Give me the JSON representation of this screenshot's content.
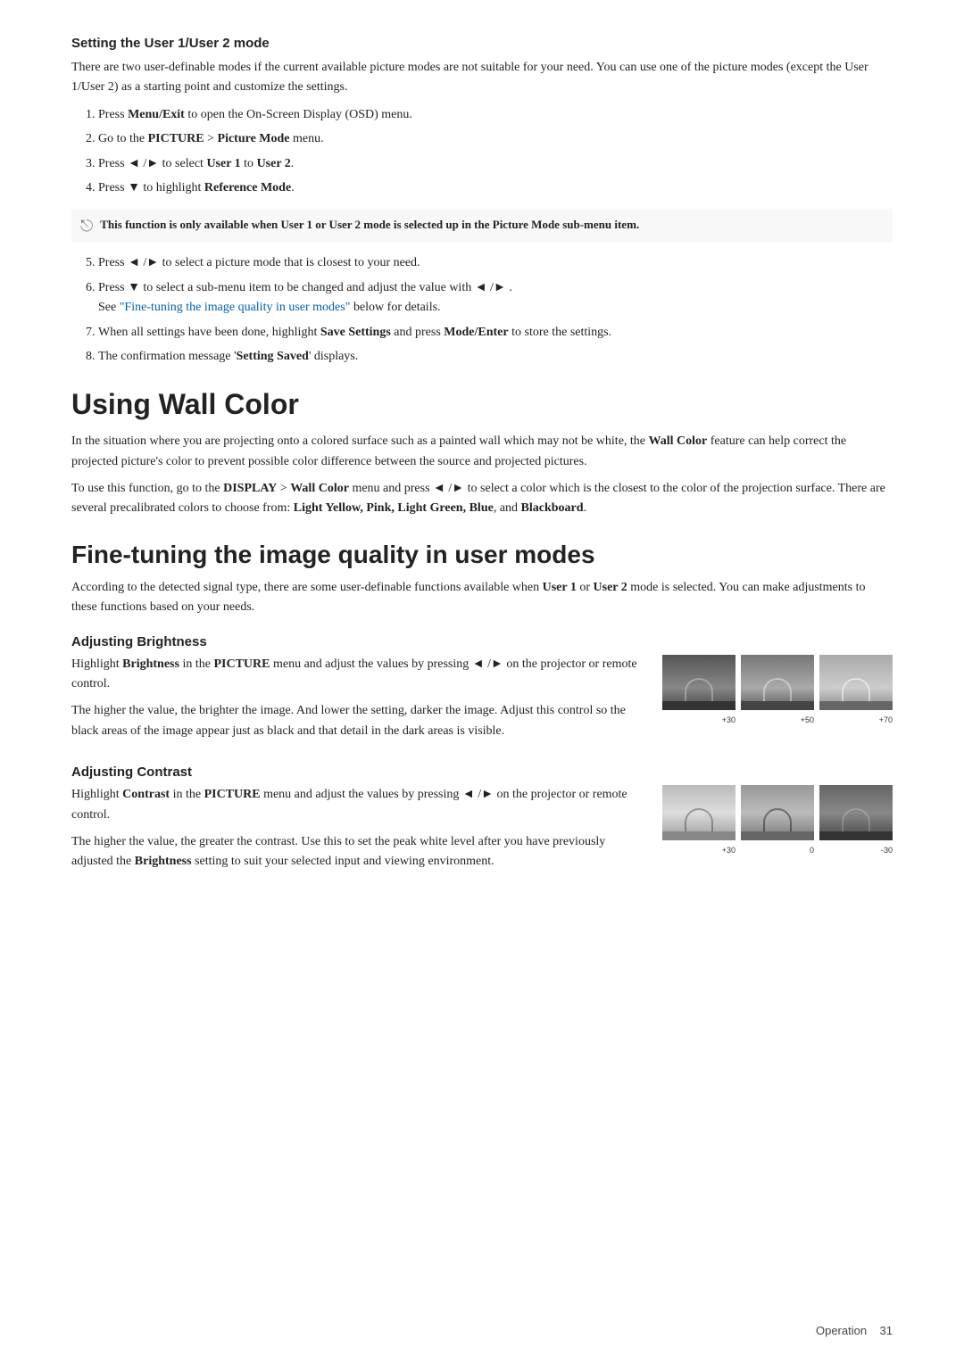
{
  "page": {
    "footer": {
      "text": "Operation",
      "page_number": "31"
    }
  },
  "section1": {
    "heading": "Setting the User 1/User 2 mode",
    "intro": "There are two user-definable modes if the current available picture modes are not suitable for your need. You can use one of the picture modes (except the User 1/User 2) as a starting point and customize the settings.",
    "steps": [
      {
        "id": 1,
        "text": "Press ",
        "bold_part": "Menu/Exit",
        "rest": " to open the On-Screen Display (OSD) menu."
      },
      {
        "id": 2,
        "text": "Go to the ",
        "bold_part": "PICTURE",
        "rest": " > ",
        "bold_part2": "Picture Mode",
        "rest2": " menu."
      },
      {
        "id": 3,
        "text_prefix": "Press ",
        "symbol": "◄ / ►",
        "text_suffix": " to select ",
        "bold_part": "User 1",
        "rest": " to ",
        "bold_part2": "User 2",
        "rest2": "."
      },
      {
        "id": 4,
        "text_prefix": "Press ",
        "symbol": "▼",
        "text_suffix": " to highlight ",
        "bold_part": "Reference Mode",
        "rest": "."
      }
    ],
    "note": "This function is only available when User 1 or User 2 mode is selected up in the Picture Mode sub-menu item.",
    "steps2": [
      {
        "id": 5,
        "text_prefix": "Press ",
        "symbol": "◄ / ►",
        "text_suffix": " to select a picture mode that is closest to your need."
      },
      {
        "id": 6,
        "text_prefix": "Press ",
        "symbol": "▼",
        "text_suffix": " to select a sub-menu item to be changed and adjust the value with ",
        "symbol2": "◄ / ►",
        "text_suffix2": " .",
        "link_text": "Fine-tuning the image quality in user modes",
        "link_suffix": " below for details."
      },
      {
        "id": 7,
        "text": "When all settings have been done, highlight ",
        "bold_part": "Save Settings",
        "rest": " and press ",
        "bold_part2": "Mode/Enter",
        "rest2": " to store the settings."
      },
      {
        "id": 8,
        "text": "The confirmation message '",
        "bold_part": "Setting Saved",
        "rest": "' displays."
      }
    ]
  },
  "section2": {
    "heading": "Using Wall Color",
    "para1": "In the situation where you are projecting onto a colored surface such as a painted wall which may not be white, the ",
    "bold1": "Wall Color",
    "para1b": " feature can help correct the projected picture's color to prevent possible color difference between the source and projected pictures.",
    "para2_prefix": "To use this function, go to the ",
    "bold2a": "DISPLAY",
    "para2b": " > ",
    "bold2c": "Wall Color",
    "para2d": " menu and press ",
    "symbol": "◄ / ►",
    "para2e": " to select a color which is the closest to the color of the projection surface. There are several precalibrated colors to choose from: ",
    "bold_colors": "Light Yellow, Pink, Light Green, Blue",
    "para2f": ", and ",
    "bold_blackboard": "Blackboard",
    "para2g": "."
  },
  "section3": {
    "heading": "Fine-tuning the image quality in user modes",
    "intro": "According to the detected signal type, there are some user-definable functions available when ",
    "bold1": "User 1",
    "intro2": " or ",
    "bold2": "User 2",
    "intro3": " mode is selected. You can make adjustments to these functions based on your needs.",
    "sub1": {
      "heading": "Adjusting Brightness",
      "para": "Highlight ",
      "bold1": "Brightness",
      "para2": " in the ",
      "bold2": "PICTURE",
      "para3": " menu and adjust the values by pressing ",
      "symbol": "◄ / ►",
      "para4": " on the projector or remote control.",
      "para_desc": "The higher the value, the brighter the image. And lower the setting, darker the image. Adjust this control so the black areas of the image appear just as black and that detail in the dark areas is visible.",
      "images": [
        {
          "label": "+30",
          "shade": "dark"
        },
        {
          "label": "+50",
          "shade": "medium"
        },
        {
          "label": "+70",
          "shade": "light"
        }
      ]
    },
    "sub2": {
      "heading": "Adjusting Contrast",
      "para": "Highlight ",
      "bold1": "Contrast",
      "para2": " in the ",
      "bold2": "PICTURE",
      "para3": " menu and adjust the values by pressing ",
      "symbol": "◄ / ►",
      "para4": " on the projector or remote control.",
      "para_desc": "The higher the value, the greater the contrast. Use this to set the peak white level after you have previously adjusted the ",
      "bold_bright": "Brightness",
      "para_desc2": " setting to suit your selected input and viewing environment.",
      "images": [
        {
          "label": "+30",
          "shade": "light"
        },
        {
          "label": "0",
          "shade": "medium"
        },
        {
          "label": "-30",
          "shade": "dark"
        }
      ]
    }
  },
  "footer": {
    "section_label": "Operation",
    "page_num": "31"
  }
}
